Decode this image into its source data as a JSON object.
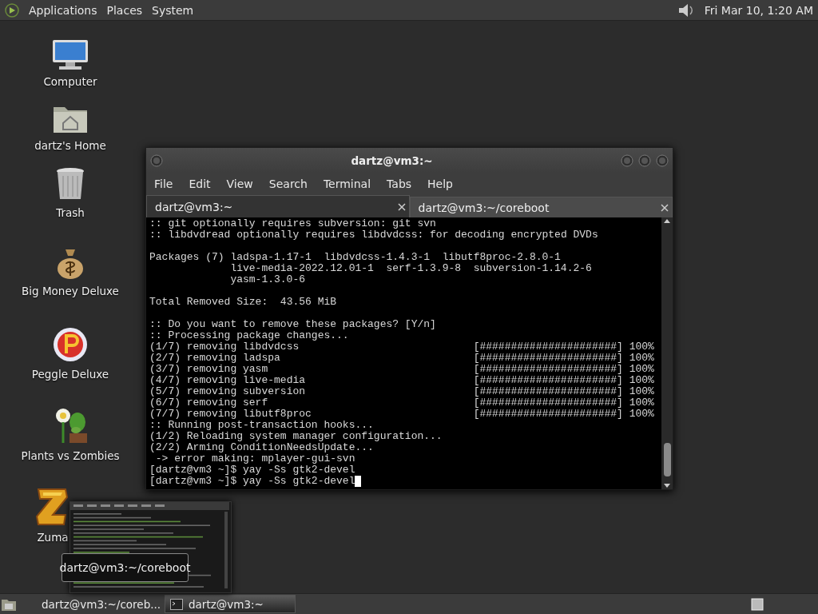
{
  "top_panel": {
    "menus": [
      "Applications",
      "Places",
      "System"
    ],
    "clock": "Fri Mar 10, 1:20 AM"
  },
  "desktop_icons": [
    {
      "label": "Computer",
      "kind": "computer"
    },
    {
      "label": "dartz's Home",
      "kind": "home"
    },
    {
      "label": "Trash",
      "kind": "trash"
    },
    {
      "label": "Big Money Deluxe",
      "kind": "money"
    },
    {
      "label": "Peggle Deluxe",
      "kind": "peggle"
    },
    {
      "label": "Plants vs Zombies",
      "kind": "plant"
    },
    {
      "label": "Zuma",
      "kind": "zuma"
    }
  ],
  "terminal": {
    "title": "dartz@vm3:~",
    "menu": [
      "File",
      "Edit",
      "View",
      "Search",
      "Terminal",
      "Tabs",
      "Help"
    ],
    "tabs": [
      {
        "label": "dartz@vm3:~",
        "selected": true
      },
      {
        "label": "dartz@vm3:~/coreboot",
        "selected": false
      }
    ],
    "lines": [
      {
        "kind": "text",
        "text": ":: git optionally requires subversion: git svn"
      },
      {
        "kind": "text",
        "text": ":: libdvdread optionally requires libdvdcss: for decoding encrypted DVDs"
      },
      {
        "kind": "blank"
      },
      {
        "kind": "text",
        "text": "Packages (7) ladspa-1.17-1  libdvdcss-1.4.3-1  libutf8proc-2.8.0-1"
      },
      {
        "kind": "indent",
        "text": "live-media-2022.12.01-1  serf-1.3.9-8  subversion-1.14.2-6"
      },
      {
        "kind": "indent",
        "text": "yasm-1.3.0-6"
      },
      {
        "kind": "blank"
      },
      {
        "kind": "text",
        "text": "Total Removed Size:  43.56 MiB"
      },
      {
        "kind": "blank"
      },
      {
        "kind": "text",
        "text": ":: Do you want to remove these packages? [Y/n]"
      },
      {
        "kind": "text",
        "text": ":: Processing package changes..."
      },
      {
        "kind": "progress",
        "text": "(1/7) removing libdvdcss",
        "bar": "[######################]",
        "percent": "100%"
      },
      {
        "kind": "progress",
        "text": "(2/7) removing ladspa",
        "bar": "[######################]",
        "percent": "100%"
      },
      {
        "kind": "progress",
        "text": "(3/7) removing yasm",
        "bar": "[######################]",
        "percent": "100%"
      },
      {
        "kind": "progress",
        "text": "(4/7) removing live-media",
        "bar": "[######################]",
        "percent": "100%"
      },
      {
        "kind": "progress",
        "text": "(5/7) removing subversion",
        "bar": "[######################]",
        "percent": "100%"
      },
      {
        "kind": "progress",
        "text": "(6/7) removing serf",
        "bar": "[######################]",
        "percent": "100%"
      },
      {
        "kind": "progress",
        "text": "(7/7) removing libutf8proc",
        "bar": "[######################]",
        "percent": "100%"
      },
      {
        "kind": "text",
        "text": ":: Running post-transaction hooks..."
      },
      {
        "kind": "text",
        "text": "(1/2) Reloading system manager configuration..."
      },
      {
        "kind": "text",
        "text": "(2/2) Arming ConditionNeedsUpdate..."
      },
      {
        "kind": "text",
        "text": " -> error making: mplayer-gui-svn"
      },
      {
        "kind": "text",
        "text": "[dartz@vm3 ~]$ yay -Ss gtk2-devel"
      },
      {
        "kind": "prompt",
        "text": "[dartz@vm3 ~]$ yay -Ss gtk2-devel",
        "cursor": true
      }
    ]
  },
  "task_preview": {
    "tooltip": "dartz@vm3:~/coreboot"
  },
  "taskbar": {
    "tasks": [
      {
        "label": "dartz@vm3:~/coreb...",
        "selected": false
      },
      {
        "label": "dartz@vm3:~",
        "selected": true
      }
    ]
  }
}
